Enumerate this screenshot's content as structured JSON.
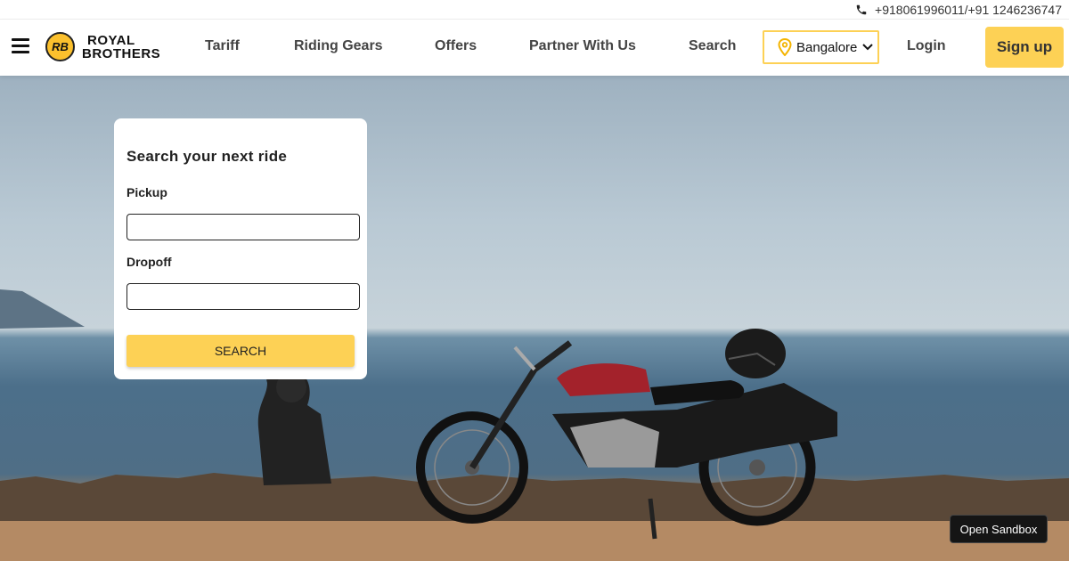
{
  "topbar": {
    "phone": "+918061996011/+91 1246236747"
  },
  "brand": {
    "badge": "RB",
    "line1": "ROYAL",
    "line2": "BROTHERS"
  },
  "nav": {
    "tariff": "Tariff",
    "riding_gears": "Riding Gears",
    "offers": "Offers",
    "partner": "Partner With Us",
    "search": "Search",
    "city": "Bangalore",
    "login": "Login",
    "signup": "Sign up"
  },
  "search_card": {
    "title": "Search your next ride",
    "pickup_label": "Pickup",
    "pickup_value": "",
    "dropoff_label": "Dropoff",
    "dropoff_value": "",
    "button": "SEARCH"
  },
  "sandbox": "Open Sandbox",
  "colors": {
    "accent": "#fdd155",
    "text": "#444444"
  },
  "icons": {
    "menu": "hamburger-icon",
    "phone": "phone-icon",
    "city": "location-pin-icon",
    "dropdown": "chevron-down-icon"
  }
}
